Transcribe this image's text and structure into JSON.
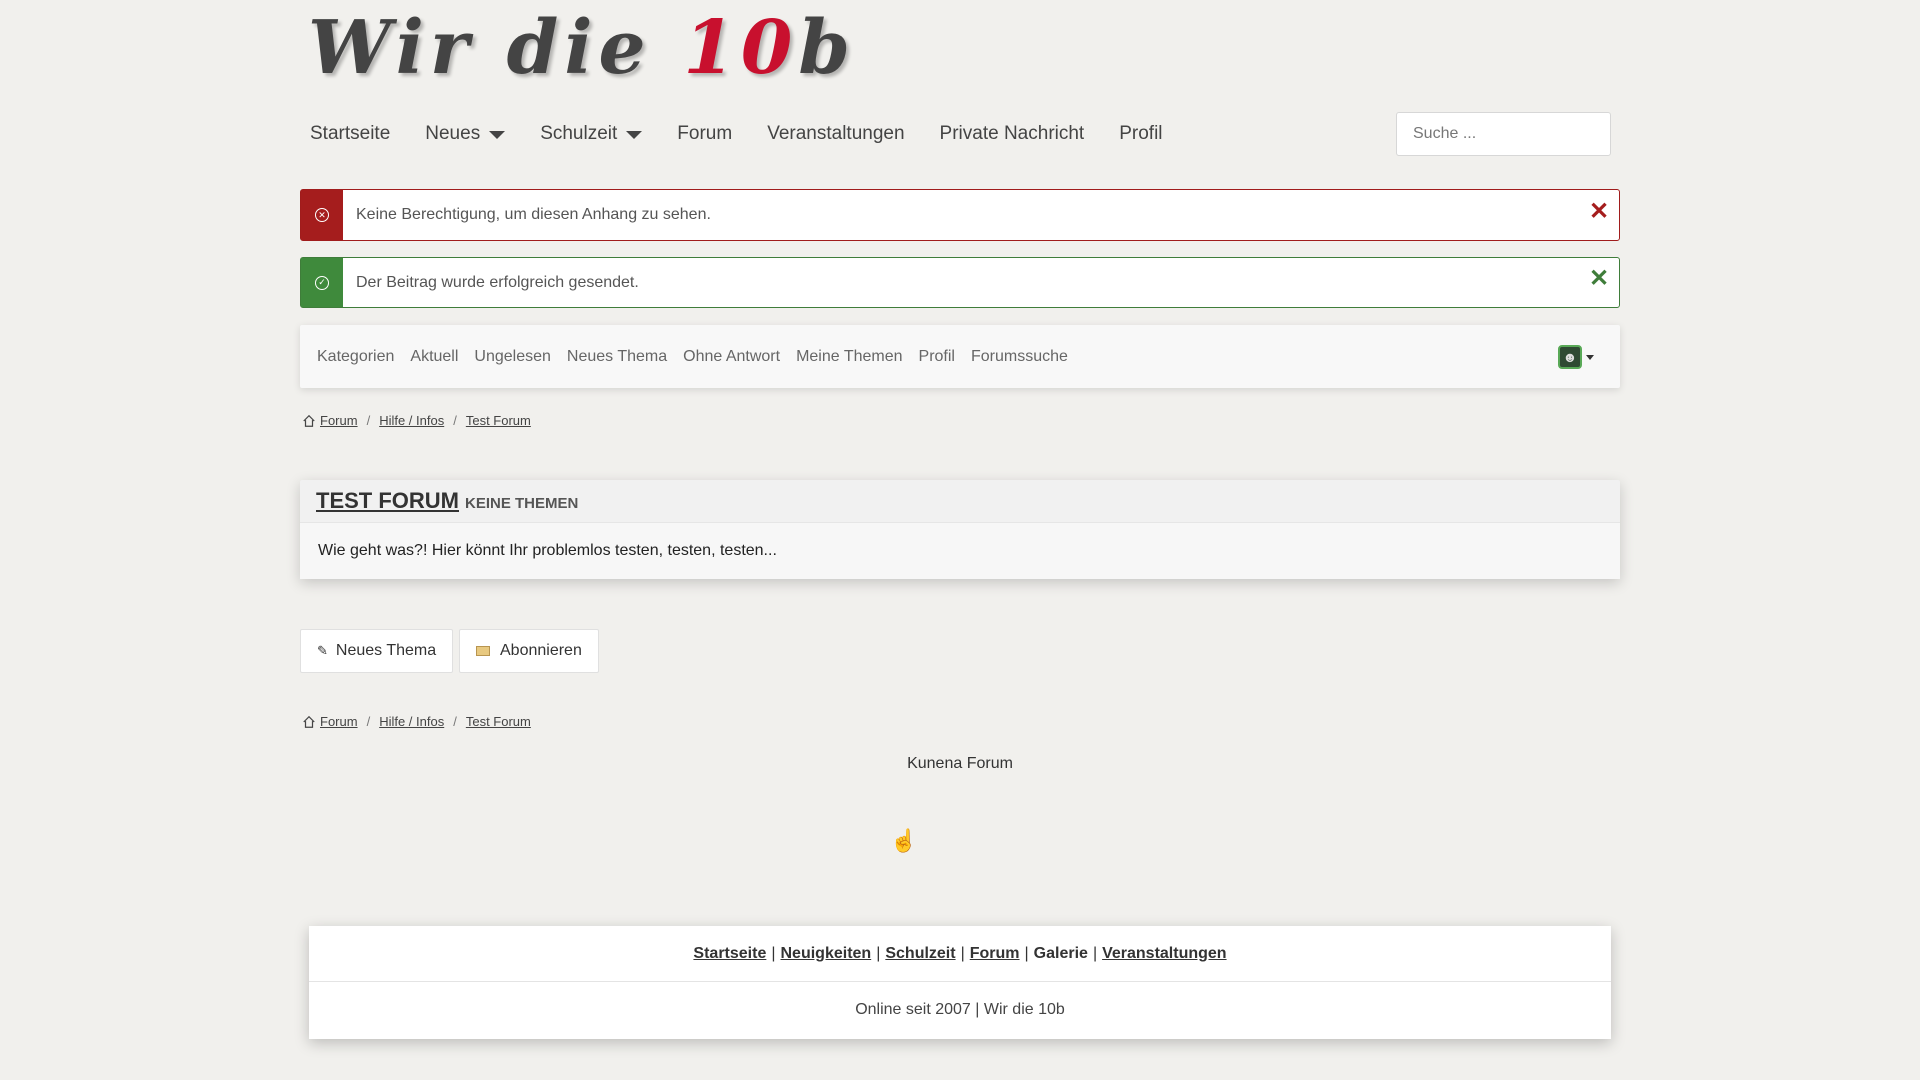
{
  "site": {
    "logo_text": "Wir die ",
    "logo_accent": "10",
    "logo_tail": "b"
  },
  "main_nav": {
    "items": [
      "Startseite",
      "Neues",
      "Schulzeit",
      "Forum",
      "Veranstaltungen",
      "Private Nachricht",
      "Profil"
    ],
    "search_placeholder": "Suche ..."
  },
  "alerts": {
    "error": {
      "message": "Keine Berechtigung, um diesen Anhang zu sehen.",
      "close": "✕"
    },
    "success": {
      "message": "Der Beitrag wurde erfolgreich gesendet.",
      "close": "✕"
    }
  },
  "forum_nav": {
    "items": [
      "Kategorien",
      "Aktuell",
      "Ungelesen",
      "Neues Thema",
      "Ohne Antwort",
      "Meine Themen",
      "Profil",
      "Forumssuche"
    ]
  },
  "breadcrumb": {
    "items": [
      "Forum",
      "Hilfe / Infos",
      "Test Forum"
    ],
    "separator": "/"
  },
  "category": {
    "title": "TEST FORUM",
    "subtitle": "KEINE THEMEN",
    "description": "Wie geht was?! Hier könnt Ihr problemlos testen, testen, testen..."
  },
  "actions": {
    "new_topic": "Neues Thema",
    "subscribe": "Abonnieren"
  },
  "powered_by": "Kunena Forum",
  "footer": {
    "links": [
      "Startseite",
      "Neuigkeiten",
      "Schulzeit",
      "Forum",
      "Galerie",
      "Veranstaltungen"
    ],
    "separator": "|",
    "copyright": "Online seit 2007 | Wir die 10b"
  },
  "colors": {
    "accent_red": "#c8102e",
    "error": "#a51d1d",
    "success": "#3f8a3c",
    "background": "#f1f0ed"
  }
}
